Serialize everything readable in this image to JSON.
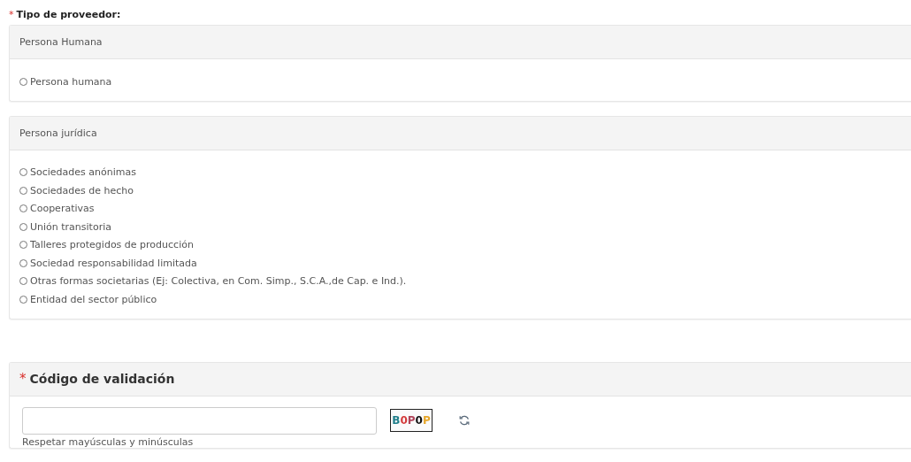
{
  "provider_type": {
    "label": "Tipo de proveedor:",
    "required_mark": "*",
    "groups": [
      {
        "heading": "Persona Humana",
        "options": [
          {
            "label": "Persona humana",
            "selected": false
          }
        ]
      },
      {
        "heading": "Persona jurídica",
        "options": [
          {
            "label": "Sociedades anónimas",
            "selected": false
          },
          {
            "label": "Sociedades de hecho",
            "selected": false
          },
          {
            "label": "Cooperativas",
            "selected": false
          },
          {
            "label": "Unión transitoria",
            "selected": false
          },
          {
            "label": "Talleres protegidos de producción",
            "selected": false
          },
          {
            "label": "Sociedad responsabilidad limitada",
            "selected": false
          },
          {
            "label": "Otras formas societarias (Ej: Colectiva, en Com. Simp., S.C.A.,de Cap. e Ind.).",
            "selected": false
          },
          {
            "label": "Entidad del sector público",
            "selected": false
          }
        ]
      }
    ]
  },
  "validation": {
    "heading": "Código de validación",
    "required_mark": "*",
    "captcha": "B0P0P",
    "hint": "Respetar mayúsculas y minúsculas"
  }
}
